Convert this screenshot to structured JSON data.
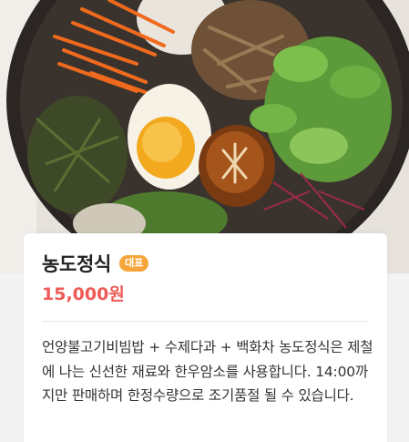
{
  "menu": {
    "image_alt": "bibimbap-photo",
    "name": "농도정식",
    "badge": "대표",
    "price": "15,000원",
    "description": "언양불고기비빔밥 + 수제다과 + 백화차 농도정식은 제철에 나는 신선한 재료와 한우암소를 사용합니다. 14:00까지만 판매하며 한정수량으로 조기품절 될 수 있습니다."
  },
  "colors": {
    "accent_price": "#ef5a56",
    "badge_bg": "#f5a53a"
  }
}
